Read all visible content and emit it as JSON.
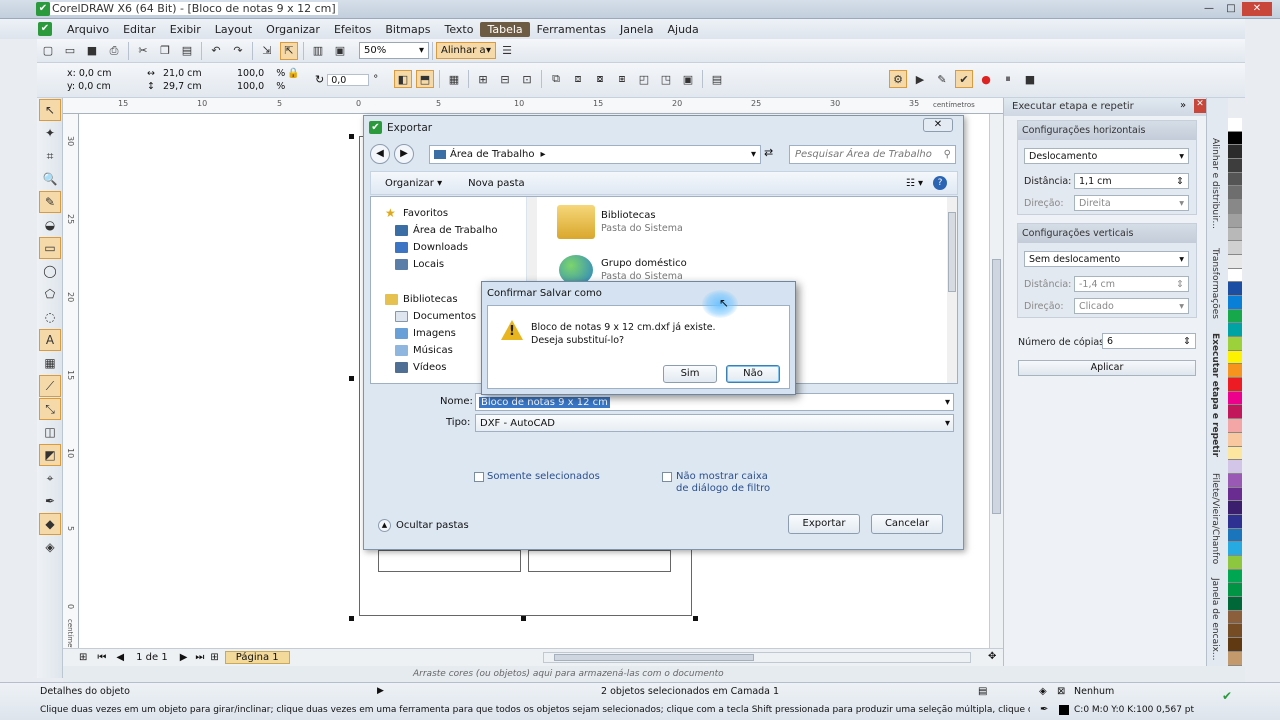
{
  "window": {
    "title": "CorelDRAW X6 (64 Bit) - [Bloco de notas 9 x 12 cm]",
    "min": "—",
    "max": "□",
    "close": "✕"
  },
  "menu": [
    "Arquivo",
    "Editar",
    "Exibir",
    "Layout",
    "Organizar",
    "Efeitos",
    "Bitmaps",
    "Texto",
    "Tabela",
    "Ferramentas",
    "Janela",
    "Ajuda"
  ],
  "toolbar": {
    "zoom": "50%",
    "align": "Alinhar a"
  },
  "props": {
    "x": "x: 0,0 cm",
    "y": "y: 0,0 cm",
    "w": "21,0 cm",
    "h": "29,7 cm",
    "sx": "100,0",
    "sy": "100,0",
    "pct1": "%",
    "pct2": "%",
    "angle": "0,0",
    "deg": "°"
  },
  "ruler": {
    "top": [
      "15",
      "10",
      "5",
      "0",
      "5",
      "10",
      "15",
      "20",
      "25",
      "30",
      "35"
    ],
    "unit": "centímetros",
    "left": [
      "30",
      "25",
      "20",
      "15",
      "10",
      "5",
      "0"
    ],
    "left_unit": "centímetros"
  },
  "nav": {
    "page_count": "1 de 1",
    "page_tab": "Página 1"
  },
  "hint": "Arraste cores (ou objetos) aqui para armazená-las com o documento",
  "status": {
    "details": "Detalhes do objeto",
    "selection": "2 objetos selecionados em Camada 1",
    "fill": "Nenhum",
    "tip": "Clique duas vezes em um objeto para girar/inclinar; clique duas vezes em uma ferramenta para que todos os objetos sejam selecionados; clique com a tecla Shift pressionada para produzir uma seleção múltipla, clique com a tecla Alt pressionada ...",
    "outline": "C:0 M:0 Y:0 K:100  0,567 pt"
  },
  "docker": {
    "header": "Executar etapa e repetir",
    "horiz_title": "Configurações horizontais",
    "horiz_mode": "Deslocamento",
    "dist_label": "Distância:",
    "dist_h": "1,1 cm",
    "dir_label": "Direção:",
    "dir_h": "Direita",
    "vert_title": "Configurações verticais",
    "vert_mode": "Sem deslocamento",
    "dist_v": "-1,4 cm",
    "dir_v": "Clicado",
    "copies_label": "Número de cópias:",
    "copies": "6",
    "apply": "Aplicar"
  },
  "sidetabs": [
    "Alinhar e distribuir...",
    "Transformações",
    "Executar etapa e repetir",
    "Filete/Vieira/Chanfro",
    "Janela de encaix..."
  ],
  "palette": [
    "#ffffff",
    "#000000",
    "#2b2b2b",
    "#3d3d3d",
    "#555555",
    "#6e6e6e",
    "#888888",
    "#a0a0a0",
    "#b8b8b8",
    "#d0d0d0",
    "#e8e8e8",
    "#ffffff",
    "#1c4fa3",
    "#0a7fd8",
    "#16a84b",
    "#00a3a3",
    "#9cd13c",
    "#fff200",
    "#f7941d",
    "#ed1c24",
    "#ec008c",
    "#c2185b",
    "#f4a6a6",
    "#f9c8a0",
    "#fde7a0",
    "#d3c5e8",
    "#9b59b6",
    "#6a2c91",
    "#3b1f6e",
    "#2e3192",
    "#1b75bc",
    "#27aae1",
    "#8dc63f",
    "#00a651",
    "#009444",
    "#006838",
    "#8b5e3c",
    "#754c24",
    "#603913",
    "#c49a6c"
  ],
  "export": {
    "title": "Exportar",
    "location": "Área de Trabalho",
    "search": "Pesquisar Área de Trabalho",
    "organize": "Organizar",
    "new_folder": "Nova pasta",
    "nav": {
      "favorites": "Favoritos",
      "desktop": "Área de Trabalho",
      "downloads": "Downloads",
      "places": "Locais",
      "libraries": "Bibliotecas",
      "documents": "Documentos",
      "images": "Imagens",
      "music": "Músicas",
      "videos": "Vídeos"
    },
    "files": [
      {
        "name": "Bibliotecas",
        "type": "Pasta do Sistema"
      },
      {
        "name": "Grupo doméstico",
        "type": "Pasta do Sistema"
      }
    ],
    "name_label": "Nome:",
    "name_value": "Bloco de notas 9 x 12 cm",
    "type_label": "Tipo:",
    "type_value": "DXF - AutoCAD",
    "only_selected": "Somente selecionados",
    "no_filter": "Não mostrar caixa de diálogo de filtro",
    "hide_folders": "Ocultar pastas",
    "export_btn": "Exportar",
    "cancel_btn": "Cancelar"
  },
  "confirm": {
    "title": "Confirmar Salvar como",
    "line1": "Bloco de notas 9 x 12 cm.dxf já existe.",
    "line2": "Deseja substituí-lo?",
    "yes": "Sim",
    "no": "Não"
  }
}
